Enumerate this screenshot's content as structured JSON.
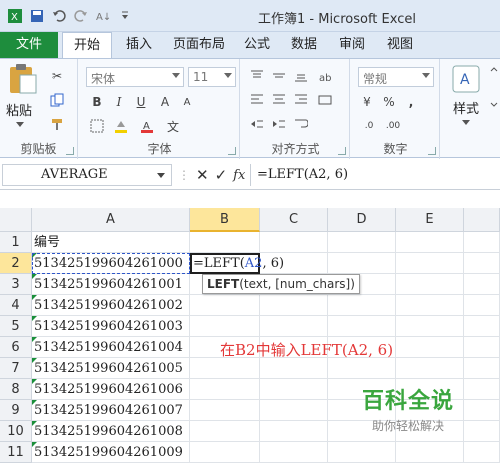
{
  "app": {
    "title": "工作簿1 - Microsoft Excel"
  },
  "ribbon_tabs": [
    "文件",
    "开始",
    "插入",
    "页面布局",
    "公式",
    "数据",
    "审阅",
    "视图"
  ],
  "ribbon": {
    "clipboard": {
      "paste_label": "粘贴",
      "group_label": "剪贴板"
    },
    "font": {
      "font_name": "宋体",
      "font_size": "11",
      "group_label": "字体"
    },
    "alignment": {
      "group_label": "对齐方式"
    },
    "number": {
      "format": "常规",
      "group_label": "数字"
    },
    "styles": {
      "label": "样式"
    }
  },
  "formula_bar": {
    "name_box": "AVERAGE",
    "fx": "fx",
    "formula": "=LEFT(A2, 6)"
  },
  "sheet": {
    "columns": [
      "A",
      "B",
      "C",
      "D",
      "E"
    ],
    "rows": [
      "1",
      "2",
      "3",
      "4",
      "5",
      "6",
      "7",
      "8",
      "9",
      "10",
      "11"
    ],
    "col_a_values": [
      "编号",
      "513425199604261000",
      "513425199604261001",
      "513425199604261002",
      "513425199604261003",
      "513425199604261004",
      "513425199604261005",
      "513425199604261006",
      "513425199604261007",
      "513425199604261008",
      "513425199604261009"
    ],
    "active_cell": {
      "prefix": "=LEFT(",
      "ref": "A2",
      "suffix": ", 6)"
    },
    "tooltip": {
      "fn": "LEFT",
      "args": "(text, [num_chars])"
    }
  },
  "annotation": "在B2中输入LEFT(A2, 6)",
  "watermark": {
    "line1": "百科全说",
    "line2": "助你轻松解决"
  },
  "colors": {
    "file_tab": "#1e8d3d",
    "selection_header": "#fde69b",
    "annotation": "#e33838",
    "reference": "#2f56c9",
    "watermark": "#3aa63e"
  }
}
